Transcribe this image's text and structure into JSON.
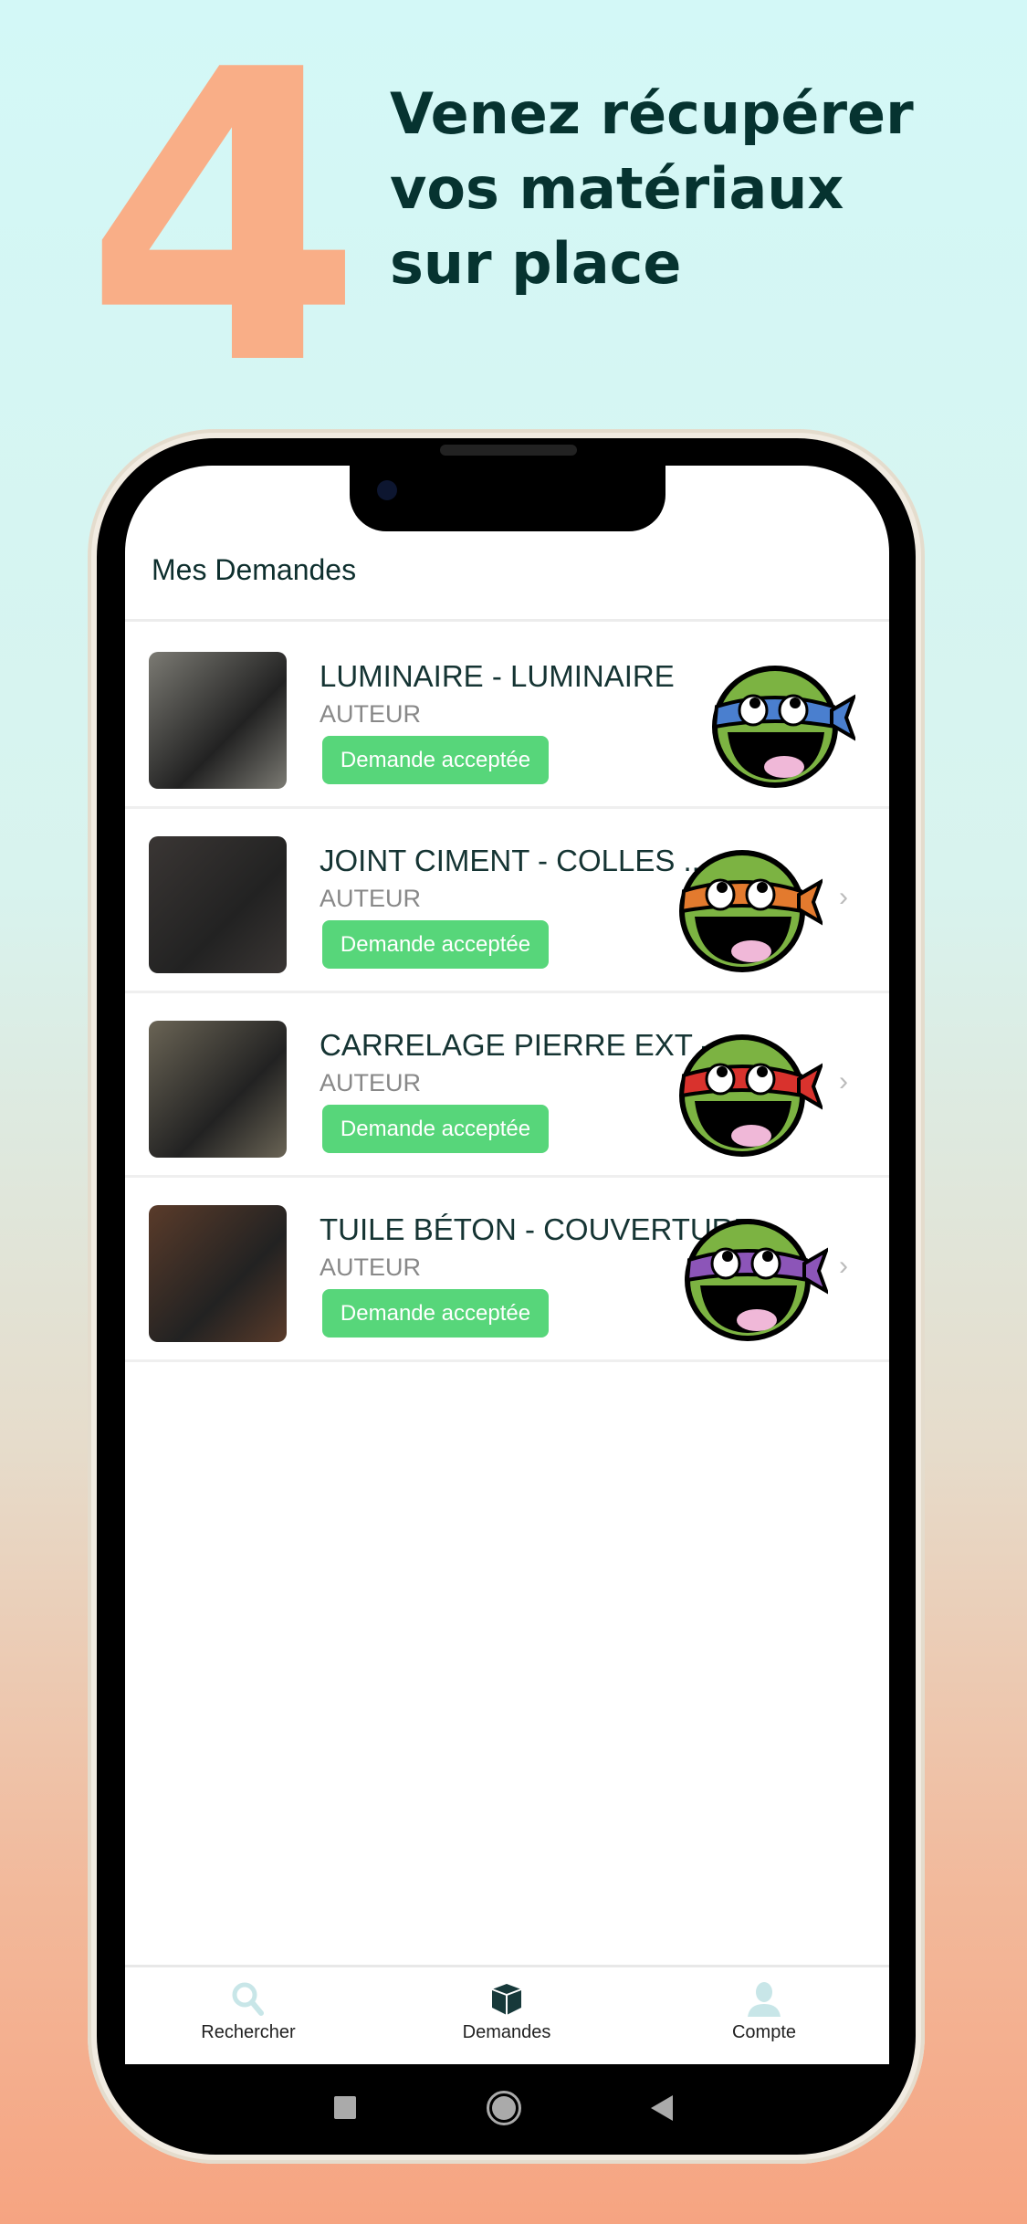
{
  "promo": {
    "step_number": "4",
    "headline_lines": [
      "Venez récupérer",
      "vos matériaux",
      "sur place"
    ],
    "accent": "#f9ae87",
    "text_color": "#063330"
  },
  "app": {
    "header_title": "Mes Demandes",
    "requests": [
      {
        "title": "LUMINAIRE - LUMINAIRE",
        "author": "AUTEUR",
        "status": "Demande acceptée",
        "bandana": "#4a7fcf",
        "thumb": "#7b7a73"
      },
      {
        "title": "JOINT CIMENT - COLLES ...",
        "author": "AUTEUR",
        "status": "Demande acceptée",
        "bandana": "#e37a2e",
        "thumb": "#3a3634"
      },
      {
        "title": "CARRELAGE PIERRE EXT -...",
        "author": "AUTEUR",
        "status": "Demande acceptée",
        "bandana": "#d9322d",
        "thumb": "#6a6455"
      },
      {
        "title": "TUILE BÉTON - COUVERTURE",
        "author": "AUTEUR",
        "status": "Demande acceptée",
        "bandana": "#8c55b8",
        "thumb": "#5a3b2a"
      }
    ],
    "tabs": [
      {
        "label": "Rechercher",
        "icon": "search-icon",
        "active": false
      },
      {
        "label": "Demandes",
        "icon": "box-icon",
        "active": true
      },
      {
        "label": "Compte",
        "icon": "user-icon",
        "active": false
      }
    ],
    "status_color": "#57d67a"
  }
}
